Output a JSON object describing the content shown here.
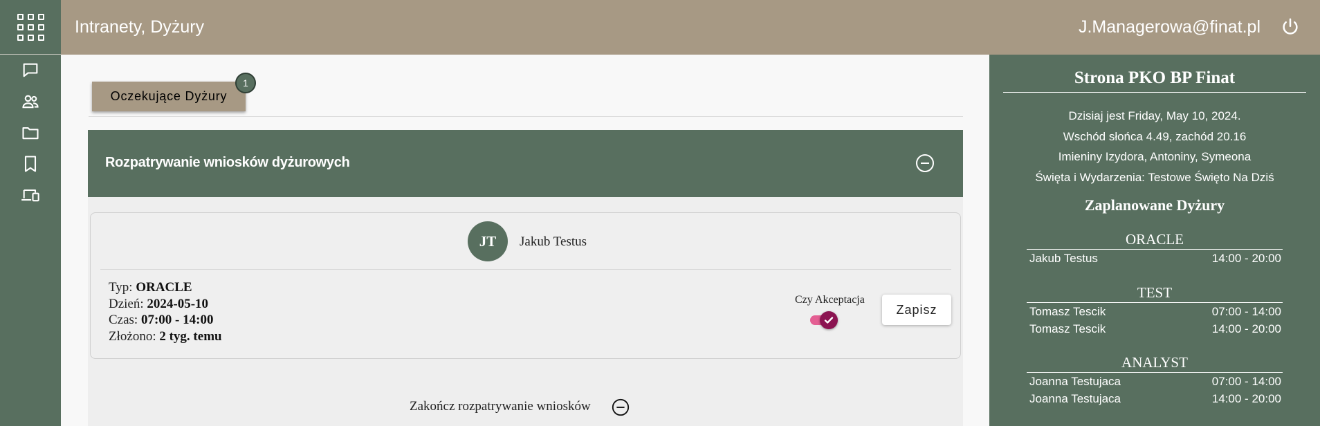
{
  "header": {
    "title": "Intranety, Dyżury",
    "user_email": "J.Managerowa@finat.pl"
  },
  "rail": {
    "icons": [
      "apps-grid-icon",
      "chat-icon",
      "people-icon",
      "folder-icon",
      "bookmark-icon",
      "devices-icon"
    ]
  },
  "main": {
    "pending_button_label": "Oczekujące Dyżury",
    "pending_count": "1",
    "panel_title": "Rozpatrywanie wniosków dyżurowych",
    "request": {
      "initials": "JT",
      "name": "Jakub Testus",
      "type_label": "Typ: ",
      "type_value": "ORACLE",
      "day_label": "Dzień: ",
      "day_value": "2024-05-10",
      "time_label": "Czas: ",
      "time_value": "07:00 - 14:00",
      "submitted_label": "Złożono: ",
      "submitted_value": "2 tyg. temu",
      "accept_label": "Czy Akceptacja",
      "accepted": true,
      "save_label": "Zapisz"
    },
    "finish_label": "Zakończ rozpatrywanie wniosków"
  },
  "side": {
    "title": "Strona PKO BP Finat",
    "info": [
      "Dzisiaj jest Friday, May 10, 2024.",
      "Wschód słońca 4.49, zachód 20.16",
      "Imieniny Izydora, Antoniny, Symeona",
      "Święta i Wydarzenia: Testowe Święto Na Dziś"
    ],
    "planned_title": "Zaplanowane Dyżury",
    "groups": [
      {
        "name": "ORACLE",
        "shifts": [
          {
            "person": "Jakub Testus",
            "time": "14:00 - 20:00"
          }
        ]
      },
      {
        "name": "TEST",
        "shifts": [
          {
            "person": "Tomasz Tescik",
            "time": "07:00 - 14:00"
          },
          {
            "person": "Tomasz Tescik",
            "time": "14:00 - 20:00"
          }
        ]
      },
      {
        "name": "ANALYST",
        "shifts": [
          {
            "person": "Joanna Testujaca",
            "time": "07:00 - 14:00"
          },
          {
            "person": "Joanna Testujaca",
            "time": "14:00 - 20:00"
          }
        ]
      }
    ]
  },
  "colors": {
    "header": "#a79984",
    "green": "#586f5f",
    "toggle_knob": "#8b1451",
    "toggle_track": "#e45f93"
  }
}
